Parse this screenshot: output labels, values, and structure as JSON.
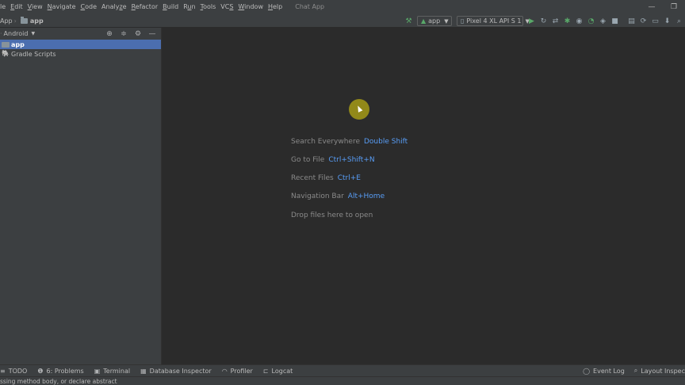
{
  "menubar": {
    "items": [
      {
        "pre": "",
        "ul": "",
        "post": "le"
      },
      {
        "pre": "",
        "ul": "E",
        "post": "dit"
      },
      {
        "pre": "",
        "ul": "V",
        "post": "iew"
      },
      {
        "pre": "",
        "ul": "N",
        "post": "avigate"
      },
      {
        "pre": "",
        "ul": "C",
        "post": "ode"
      },
      {
        "pre": "Analy",
        "ul": "z",
        "post": "e"
      },
      {
        "pre": "",
        "ul": "R",
        "post": "efactor"
      },
      {
        "pre": "",
        "ul": "B",
        "post": "uild"
      },
      {
        "pre": "R",
        "ul": "u",
        "post": "n"
      },
      {
        "pre": "",
        "ul": "T",
        "post": "ools"
      },
      {
        "pre": "VC",
        "ul": "S",
        "post": ""
      },
      {
        "pre": "",
        "ul": "W",
        "post": "indow"
      },
      {
        "pre": "",
        "ul": "H",
        "post": "elp"
      }
    ],
    "project_title": "Chat App",
    "controls": {
      "minimize": "—",
      "restore": "❐"
    }
  },
  "navbar": {
    "crumb_root": "App",
    "crumb_module": "app",
    "run_config": "app",
    "device": "Pixel 4 XL API S 1"
  },
  "project_panel": {
    "view_mode": "Android",
    "tree": [
      {
        "label": "app",
        "selected": true
      },
      {
        "label": "Gradle Scripts",
        "selected": false
      }
    ]
  },
  "editor_hints": [
    {
      "action": "Search Everywhere",
      "shortcut": "Double Shift"
    },
    {
      "action": "Go to File",
      "shortcut": "Ctrl+Shift+N"
    },
    {
      "action": "Recent Files",
      "shortcut": "Ctrl+E"
    },
    {
      "action": "Navigation Bar",
      "shortcut": "Alt+Home"
    },
    {
      "action": "Drop files here to open",
      "shortcut": ""
    }
  ],
  "tool_windows": {
    "left": [
      {
        "label": "TODO",
        "icon": "list-icon"
      },
      {
        "label": "6: Problems",
        "icon": "problems-icon"
      },
      {
        "label": "Terminal",
        "icon": "terminal-icon"
      },
      {
        "label": "Database Inspector",
        "icon": "database-icon"
      },
      {
        "label": "Profiler",
        "icon": "profiler-icon"
      },
      {
        "label": "Logcat",
        "icon": "logcat-icon"
      }
    ],
    "right": [
      {
        "label": "Event Log",
        "icon": "event-log-icon"
      },
      {
        "label": "Layout Inspec",
        "icon": "layout-inspector-icon"
      }
    ]
  },
  "status": {
    "message": "ssing method body, or declare abstract"
  },
  "colors": {
    "accent": "#4b6eaf",
    "shortcut": "#589df6",
    "run_green": "#59a869",
    "panel_bg": "#3c3f41",
    "editor_bg": "#2b2b2b"
  }
}
